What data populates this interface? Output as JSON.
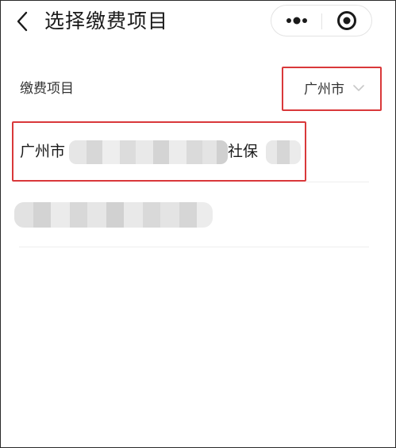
{
  "navbar": {
    "title": "选择缴费项目",
    "back_icon": "chevron-left-icon",
    "more_icon": "more-dots-icon",
    "close_icon": "target-close-icon"
  },
  "section": {
    "label": "缴费项目",
    "city_select": {
      "value": "广州市",
      "icon": "chevron-down-icon"
    }
  },
  "items": [
    {
      "prefix": "广州市",
      "suffix": "社保"
    }
  ],
  "colors": {
    "highlight_border": "#d9383a",
    "text_primary": "#1a1a1a",
    "text_secondary": "#333333",
    "divider": "#eeeeee",
    "capsule_border": "#e3e3e3",
    "arrow": "#c8c8c8"
  }
}
